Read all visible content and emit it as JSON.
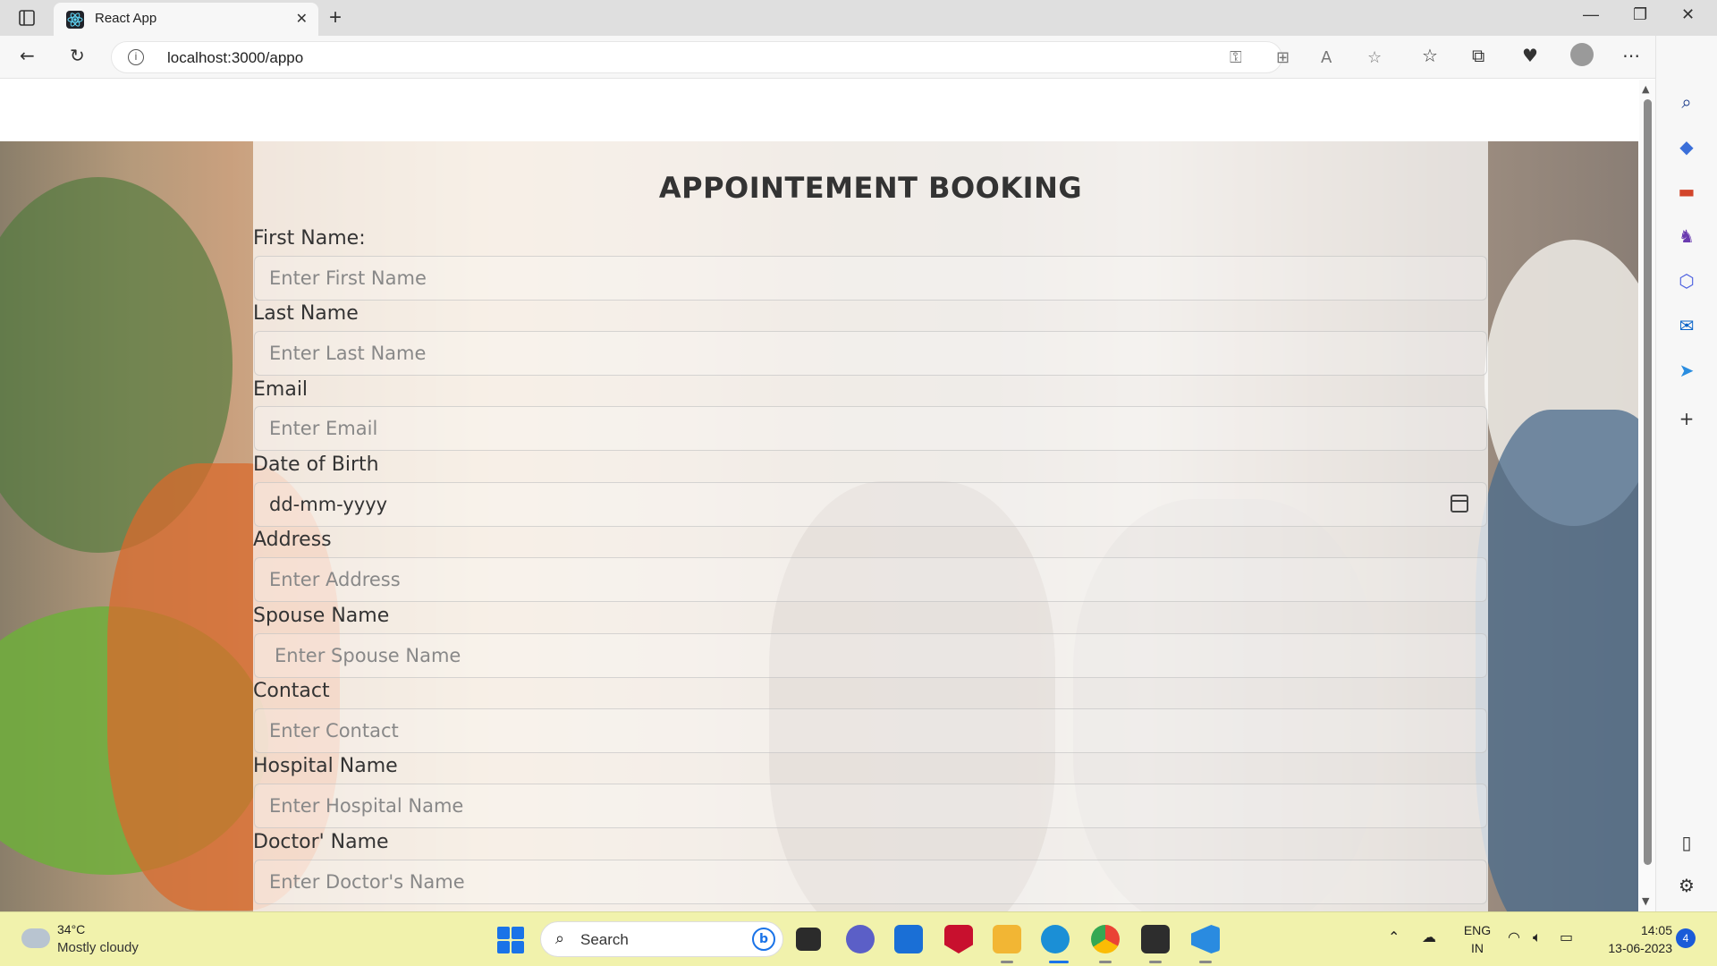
{
  "browser": {
    "tab_title": "React App",
    "url": "localhost:3000/appo",
    "new_tab_glyph": "+",
    "tab_close_glyph": "✕"
  },
  "page": {
    "title": "APPOINTEMENT BOOKING",
    "fields": [
      {
        "label": "First Name:",
        "placeholder": "Enter First Name"
      },
      {
        "label": "Last Name",
        "placeholder": "Enter Last Name"
      },
      {
        "label": "Email",
        "placeholder": "Enter Email"
      },
      {
        "label": "Date of Birth",
        "value": "dd-mm-yyyy"
      },
      {
        "label": "Address",
        "placeholder": "Enter Address"
      },
      {
        "label": "Spouse Name",
        "placeholder": "Enter Spouse Name"
      },
      {
        "label": "Contact",
        "placeholder": "Enter Contact"
      },
      {
        "label": "Hospital Name",
        "placeholder": "Enter Hospital Name"
      },
      {
        "label": "Doctor' Name",
        "placeholder": "Enter Doctor's Name"
      }
    ]
  },
  "taskbar": {
    "weather_temp": "34°C",
    "weather_desc": "Mostly cloudy",
    "search_label": "Search",
    "lang_top": "ENG",
    "lang_bottom": "IN",
    "time": "14:05",
    "date": "13-06-2023",
    "notification_count": "4"
  },
  "colors": {
    "taskbar_bg": "#f1f2ac",
    "accent": "#1a73e8",
    "overlay": "rgba(255,255,255,0.72)"
  }
}
